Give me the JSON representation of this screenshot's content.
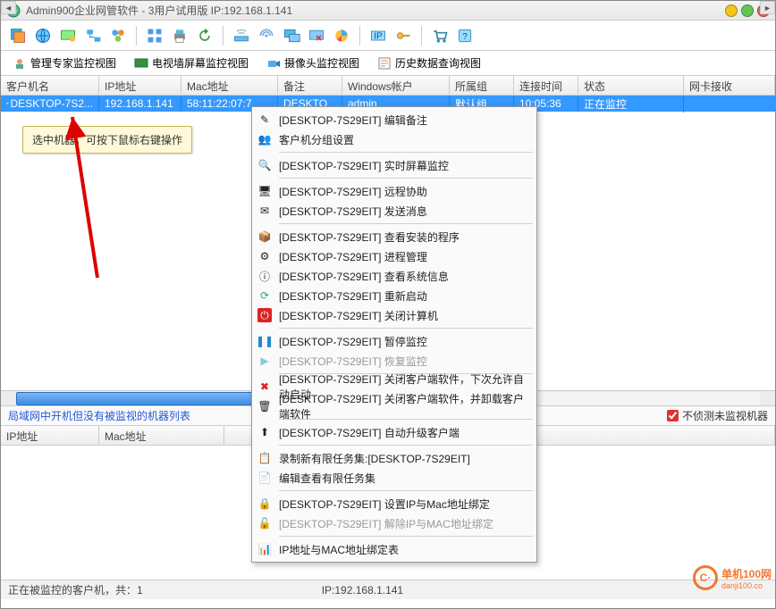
{
  "window": {
    "title": "Admin900企业网管软件 - 3用户试用版 IP:192.168.1.141"
  },
  "tabs": {
    "expert": "管理专家监控视图",
    "tv": "电视墙屏幕监控视图",
    "camera": "摄像头监控视图",
    "history": "历史数据查询视图"
  },
  "columns": {
    "client": "客户机名",
    "ip": "IP地址",
    "mac": "Mac地址",
    "note": "备注",
    "winuser": "Windows帐户",
    "group": "所属组",
    "conn": "连接时间",
    "status": "状态",
    "nic": "网卡接收"
  },
  "row0": {
    "client": "DESKTOP-7S2...",
    "ip": "192.168.1.141",
    "mac": "58:11:22:07:7",
    "note": "DESKTO",
    "winuser": "admin",
    "group": "默认组",
    "conn": "10:05:36",
    "status": "正在监控"
  },
  "hint": "选中机器，可按下鼠标右键操作",
  "menu": {
    "m1": "[DESKTOP-7S29EIT] 编辑备注",
    "m2": "客户机分组设置",
    "m3": "[DESKTOP-7S29EIT] 实时屏幕监控",
    "m4": "[DESKTOP-7S29EIT] 远程协助",
    "m5": "[DESKTOP-7S29EIT] 发送消息",
    "m6": "[DESKTOP-7S29EIT] 查看安装的程序",
    "m7": "[DESKTOP-7S29EIT] 进程管理",
    "m8": "[DESKTOP-7S29EIT] 查看系统信息",
    "m9": "[DESKTOP-7S29EIT] 重新启动",
    "m10": "[DESKTOP-7S29EIT] 关闭计算机",
    "m11": "[DESKTOP-7S29EIT] 暂停监控",
    "m12": "[DESKTOP-7S29EIT] 恢复监控",
    "m13": "[DESKTOP-7S29EIT] 关闭客户端软件，下次允许自动启动",
    "m14": "[DESKTOP-7S29EIT] 关闭客户端软件，并卸载客户端软件",
    "m15": "[DESKTOP-7S29EIT] 自动升级客户端",
    "m16a": "录制新有限任务集:[DESKTOP-7S29EIT]",
    "m16b": "编辑查看有限任务集",
    "m17": "[DESKTOP-7S29EIT] 设置IP与Mac地址绑定",
    "m18": "[DESKTOP-7S29EIT] 解除IP与MAC地址绑定",
    "m19": "IP地址与MAC地址绑定表"
  },
  "lower": {
    "caption": "局域网中开机但没有被监视的机器列表",
    "chk": "不侦测未监视机器",
    "ip": "IP地址",
    "mac": "Mac地址"
  },
  "status": {
    "a": "正在被监控的客户机，共：1",
    "b": "IP:192.168.1.141"
  },
  "watermark": {
    "txt": "单机100网",
    "sub": "danji100.co"
  }
}
